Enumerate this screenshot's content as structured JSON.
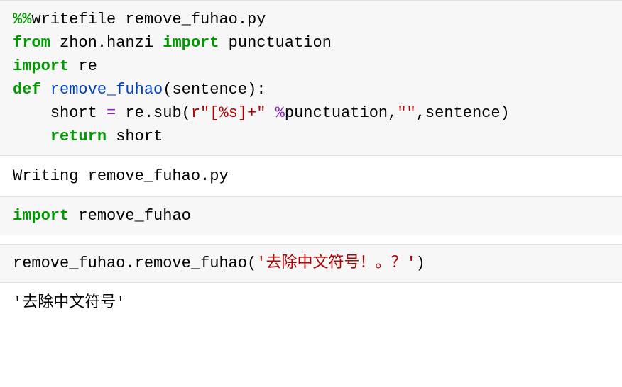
{
  "cell1": {
    "magic": "%%",
    "writefile": "writefile remove_fuhao.py",
    "from": "from",
    "module1": " zhon.hanzi ",
    "import1": "import",
    "punct": " punctuation",
    "import2": "import",
    "re": " re",
    "def": "def",
    "fname": " remove_fuhao",
    "fsig": "(sentence):",
    "indent1": "    short ",
    "eq": "=",
    "resub": " re.sub(",
    "str1": "r\"[%s]+\"",
    "pct": " %",
    "rest1": "punctuation,",
    "str2": "\"\"",
    "rest2": ",sentence)",
    "indent2": "    ",
    "return": "return",
    "short": " short"
  },
  "output1": "Writing remove_fuhao.py",
  "cell2": {
    "import": "import",
    "module": " remove_fuhao"
  },
  "cell3": {
    "call_pre": "remove_fuhao.remove_fuhao(",
    "arg": "'去除中文符号！。？'",
    "call_post": ")"
  },
  "output3": "'去除中文符号'"
}
